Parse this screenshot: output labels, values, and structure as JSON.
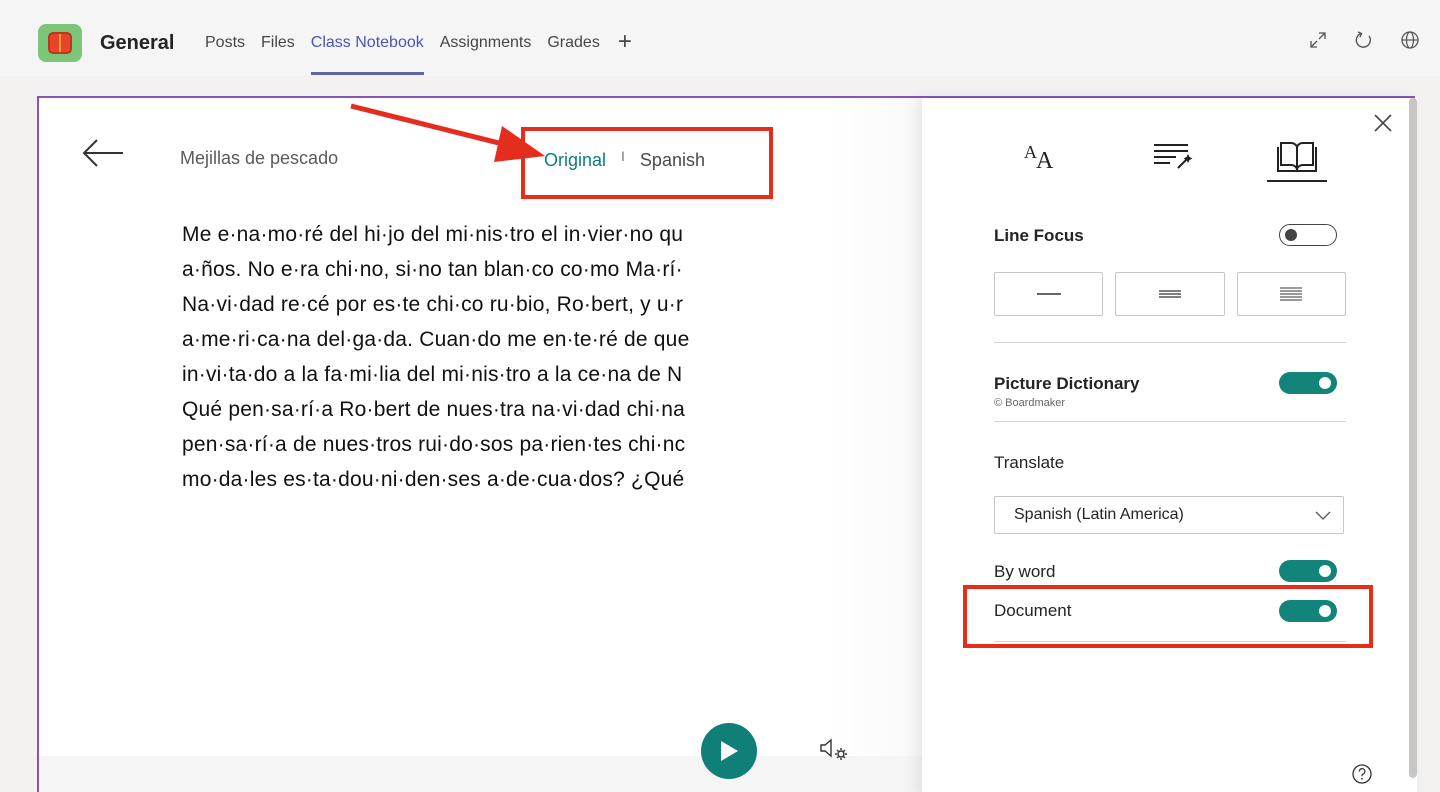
{
  "header": {
    "team_name": "General",
    "tabs": [
      {
        "label": "Posts"
      },
      {
        "label": "Files"
      },
      {
        "label": "Class Notebook"
      },
      {
        "label": "Assignments"
      },
      {
        "label": "Grades"
      }
    ],
    "add_tab": "+"
  },
  "reader": {
    "title": "Mejillas de pescado",
    "lang_original": "Original",
    "lang_separator": "I",
    "lang_spanish": "Spanish",
    "lines": [
      "Me e·na·mo·ré del hi·jo del mi·nis·tro el in·vier·no qu",
      "a·ños. No e·ra chi·no, si·no tan blan·co co·mo Ma·rí·",
      "Na·vi·dad re·cé por es·te chi·co ru·bio, Ro·bert, y u·r",
      "a·me·ri·ca·na del·ga·da. Cuan·do me en·te·ré de que",
      "in·vi·ta·do a la fa·mi·lia del mi·nis·tro a la ce·na de N",
      "Qué pen·sa·rí·a Ro·bert de nues·tra na·vi·dad chi·na",
      "pen·sa·rí·a de nues·tros rui·do·sos pa·rien·tes chi·nc",
      "mo·da·les es·ta·dou·ni·den·ses a·de·cua·dos? ¿Qué"
    ]
  },
  "panel": {
    "line_focus_label": "Line Focus",
    "picture_dictionary_label": "Picture Dictionary",
    "picture_dictionary_credit": "© Boardmaker",
    "translate_label": "Translate",
    "translate_language": "Spanish (Latin America)",
    "by_word_label": "By word",
    "document_label": "Document",
    "toggles": {
      "line_focus": false,
      "picture_dictionary": true,
      "by_word": true,
      "document": true
    }
  },
  "colors": {
    "accent_teal": "#128479",
    "teams_purple": "#6264a7",
    "annotation_red": "#e52d1e"
  }
}
